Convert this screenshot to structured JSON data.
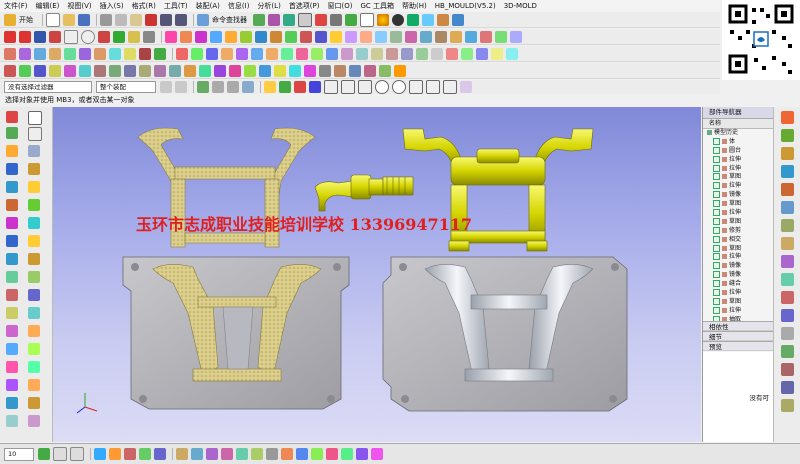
{
  "menu": {
    "items": [
      "文件(F)",
      "编辑(E)",
      "视图(V)",
      "插入(S)",
      "格式(R)",
      "工具(T)",
      "装配(A)",
      "信息(I)",
      "分析(L)",
      "首选项(P)",
      "窗口(O)",
      "GC 工具箱",
      "帮助(H)",
      "HB_MOULD(V5.2)",
      "3D-MOLD"
    ],
    "start_label": "开始",
    "command_finder": "命令查找器"
  },
  "selection": {
    "filter_value": "没有选择过滤器",
    "scope_value": "整个装配"
  },
  "cue_line": "选择对象并使用 MB3，或者双击某一对象",
  "graphics": {
    "banner": "玉环市志成职业技能培训学校  13396947117"
  },
  "navigator": {
    "title": "部件导航器",
    "col_name": "名称",
    "items": [
      "模型历史",
      "体",
      "圆台",
      "拉伸",
      "拉伸",
      "草图",
      "拉伸",
      "镜像",
      "草图",
      "拉伸",
      "草图",
      "修剪",
      "相交",
      "草图",
      "拉伸",
      "镜像",
      "镜像",
      "缝合",
      "拉伸",
      "草图",
      "拉伸",
      "抽取",
      "抽取",
      "加厚"
    ],
    "panels": {
      "dependencies": "相依性",
      "details": "细节",
      "preview": "预览"
    },
    "preview_status": "没有可"
  },
  "statusbar": {
    "zoom_value": "10"
  },
  "colors": {
    "banner": "#e02020",
    "gold": "#d4d400",
    "sand": "#d8cc8a",
    "viewport_top": "#8089d8",
    "viewport_bottom": "#dcdcf5"
  }
}
